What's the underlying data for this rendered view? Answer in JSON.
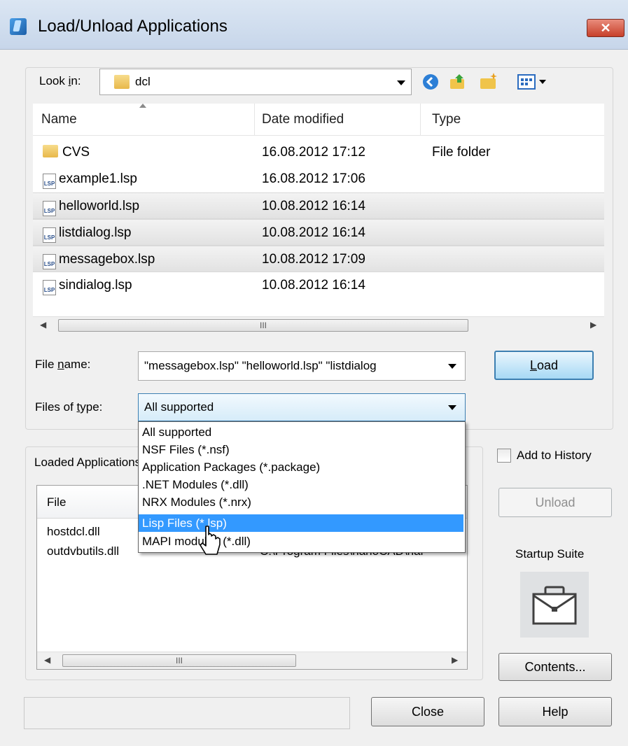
{
  "window": {
    "title": "Load/Unload Applications",
    "close_glyph": "✕"
  },
  "lookin": {
    "label_pre": "Look ",
    "label_u": "i",
    "label_post": "n:",
    "value": "dcl"
  },
  "toolbar": {
    "back_icon": "back-arrow-icon",
    "up_icon": "up-folder-icon",
    "newfolder_icon": "new-folder-icon",
    "views_icon": "views-menu-icon"
  },
  "file_columns": {
    "name": "Name",
    "date": "Date modified",
    "type": "Type"
  },
  "files": [
    {
      "name": "CVS",
      "date": "16.08.2012 17:12",
      "type": "File folder",
      "icon": "folder-icon"
    },
    {
      "name": "example1.lsp",
      "date": "16.08.2012 17:06",
      "type": "",
      "icon": "lsp-file-icon"
    },
    {
      "name": "helloworld.lsp",
      "date": "10.08.2012 16:14",
      "type": "",
      "icon": "lsp-file-icon"
    },
    {
      "name": "listdialog.lsp",
      "date": "10.08.2012 16:14",
      "type": "",
      "icon": "lsp-file-icon"
    },
    {
      "name": "messagebox.lsp",
      "date": "10.08.2012 17:09",
      "type": "",
      "icon": "lsp-file-icon"
    },
    {
      "name": "sindialog.lsp",
      "date": "10.08.2012 16:14",
      "type": "",
      "icon": "lsp-file-icon"
    }
  ],
  "lsp_badge": "LSP",
  "scroll_grip": "III",
  "filename": {
    "label_pre": "File ",
    "label_u": "n",
    "label_post": "ame:",
    "value": "\"messagebox.lsp\" \"helloworld.lsp\" \"listdialog"
  },
  "load_button": {
    "label": "Load",
    "u": "L",
    "rest": "oad"
  },
  "filetype": {
    "label_pre": "Files of ",
    "label_u": "t",
    "label_post": "ype:",
    "value": "All supported"
  },
  "filetype_options": [
    "All supported",
    "NSF Files (*.nsf)",
    "Application Packages (*.package)",
    ".NET Modules (*.dll)",
    "NRX Modules (*.nrx)",
    "Lisp Files (*.lsp)",
    "MAPI modules (*.dll)"
  ],
  "highlighted_option": "Lisp Files (*.lsp)",
  "loaded": {
    "label": "Loaded Applications",
    "column_file": "File",
    "rows": [
      {
        "file": "hostdcl.dll",
        "path": ""
      },
      {
        "file": "outdvbutils.dll",
        "path": "C:\\Program Files\\nanoCAD\\nar"
      }
    ]
  },
  "add_to_history": {
    "label": "Add to History",
    "checked": false
  },
  "unload_button": "Unload",
  "startup_suite": {
    "label": "Startup Suite",
    "icon": "briefcase-icon"
  },
  "contents_button": "Contents...",
  "close_button": "Close",
  "help_button": "Help",
  "colors": {
    "accent": "#3399ff",
    "default_button_border": "#3c7fb1",
    "close_red": "#c7402a"
  }
}
